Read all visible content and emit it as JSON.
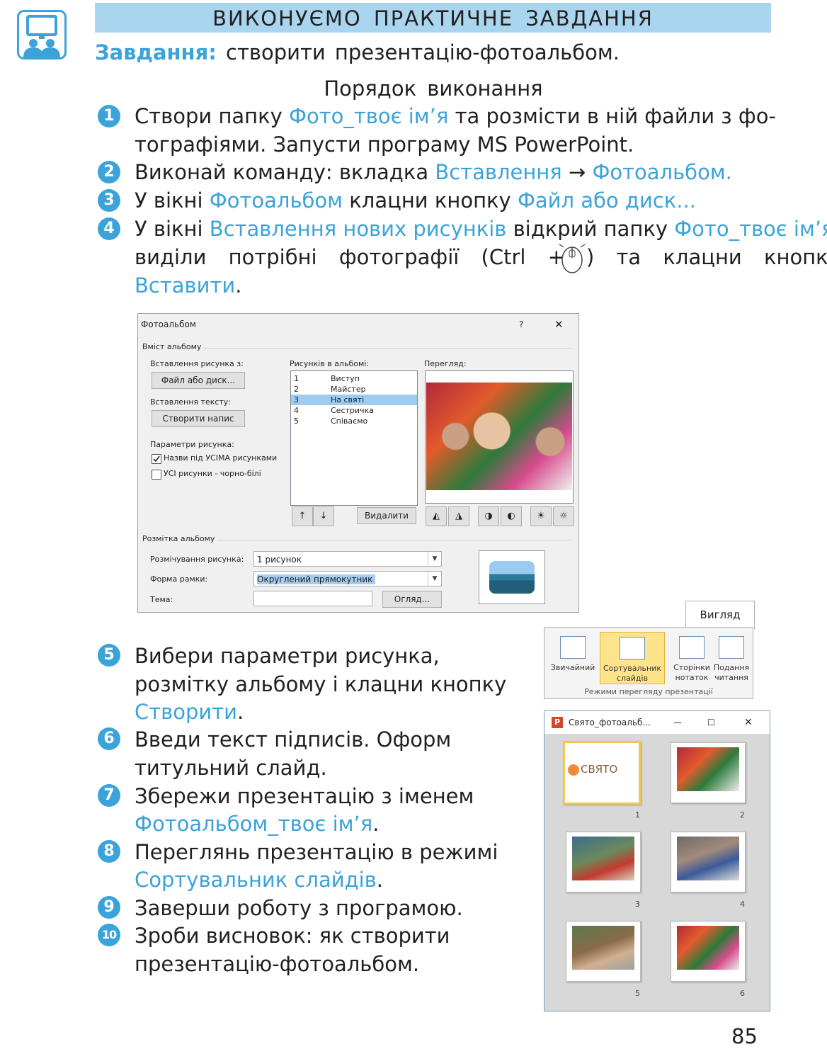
{
  "header": {
    "title": "ВИКОНУЄМО ПРАКТИЧНЕ ЗАВДАННЯ"
  },
  "task": {
    "label": "Завдання:",
    "text": " створити презентацію-фотоальбом."
  },
  "order_title": "Порядок виконання",
  "steps": [
    {
      "num": "1",
      "l1a": "Створи папку ",
      "l1b": "Фото_твоє ім’я",
      "l1c": " та розмісти в ній файли з фо-",
      "l2": "тографіями. Запусти програму MS PowerPoint."
    },
    {
      "num": "2",
      "a": "Виконай команду: вкладка ",
      "b": "Вставлення",
      "c": " → ",
      "d": "Фотоальбом."
    },
    {
      "num": "3",
      "a": "У вікні ",
      "b": "Фотоальбом",
      "c": " клацни кнопку ",
      "d": "Файл або диск..."
    },
    {
      "num": "4",
      "a": "У вікні ",
      "b": "Вставлення нових рисунків",
      "c": " відкрий папку ",
      "d": "Фото_твоє ім’я",
      "e": ",",
      "l2a": "виділи потрібні фотографії (Ctrl +",
      "l2b": ") та клацни кнопку",
      "l3": "Вставити",
      "l3e": "."
    },
    {
      "num": "5",
      "l1": "Вибери параметри рисунка,",
      "l2": "розмітку альбому і клацни кнопку",
      "l3": "Створити",
      "l3e": "."
    },
    {
      "num": "6",
      "l1": "Введи текст підписів. Оформ",
      "l2": "титульний слайд."
    },
    {
      "num": "7",
      "l1": "Збережи презентацію з іменем",
      "l2": "Фотоальбом_твоє ім’я",
      "l2e": "."
    },
    {
      "num": "8",
      "l1": "Переглянь презентацію в режимі",
      "l2": "Сортувальник слайдів",
      "l2e": "."
    },
    {
      "num": "9",
      "l1": "Заверши роботу з програмою."
    },
    {
      "num": "10",
      "l1": "Зроби висновок: як створити",
      "l2": "презентацію-фотоальбом."
    }
  ],
  "dialog": {
    "title": "Фотоальбом",
    "help": "?",
    "close": "✕",
    "content_group": "Вміст альбому",
    "insert_from": "Вставлення рисунка з:",
    "file_btn": "Файл або диск...",
    "insert_text": "Вставлення тексту:",
    "caption_btn": "Створити напис",
    "pic_options": "Параметри рисунка:",
    "opt1": "Назви під УСІМА рисунками",
    "opt2": "УСІ рисунки - чорно-білі",
    "pics_label": "Рисунків в альбомі:",
    "pics": [
      {
        "n": "1",
        "name": "Виступ"
      },
      {
        "n": "2",
        "name": "Майстер"
      },
      {
        "n": "3",
        "name": "На святі"
      },
      {
        "n": "4",
        "name": "Сестричка"
      },
      {
        "n": "5",
        "name": "Співаємо"
      }
    ],
    "preview_label": "Перегляд:",
    "up": "↑",
    "down": "↓",
    "remove_btn": "Видалити",
    "layout_group": "Розмітка альбому",
    "pic_layout_label": "Розмічування рисунка:",
    "pic_layout_value": "1 рисунок",
    "frame_label": "Форма рамки:",
    "frame_value": "Округлений прямокутник",
    "theme_label": "Тема:",
    "browse_btn": "Огляд..."
  },
  "ribbon": {
    "tab": "Вигляд",
    "buttons": [
      {
        "l1": "Звичайний",
        "l2": ""
      },
      {
        "l1": "Сортувальник",
        "l2": "слайдів"
      },
      {
        "l1": "Сторінки",
        "l2": "нотаток"
      },
      {
        "l1": "Подання",
        "l2": "читання"
      }
    ],
    "group": "Режими перегляду презентації"
  },
  "window": {
    "title": "Свято_фотоальб...",
    "min": "—",
    "max": "☐",
    "close": "✕",
    "title_slide_text": "СВЯТО",
    "slide_numbers": [
      "1",
      "2",
      "3",
      "4",
      "5",
      "6"
    ]
  },
  "page_number": "85",
  "colors": {
    "accent": "#3ba3d9",
    "header_bar": "#a9d6ee",
    "selected": "#fde38a"
  }
}
